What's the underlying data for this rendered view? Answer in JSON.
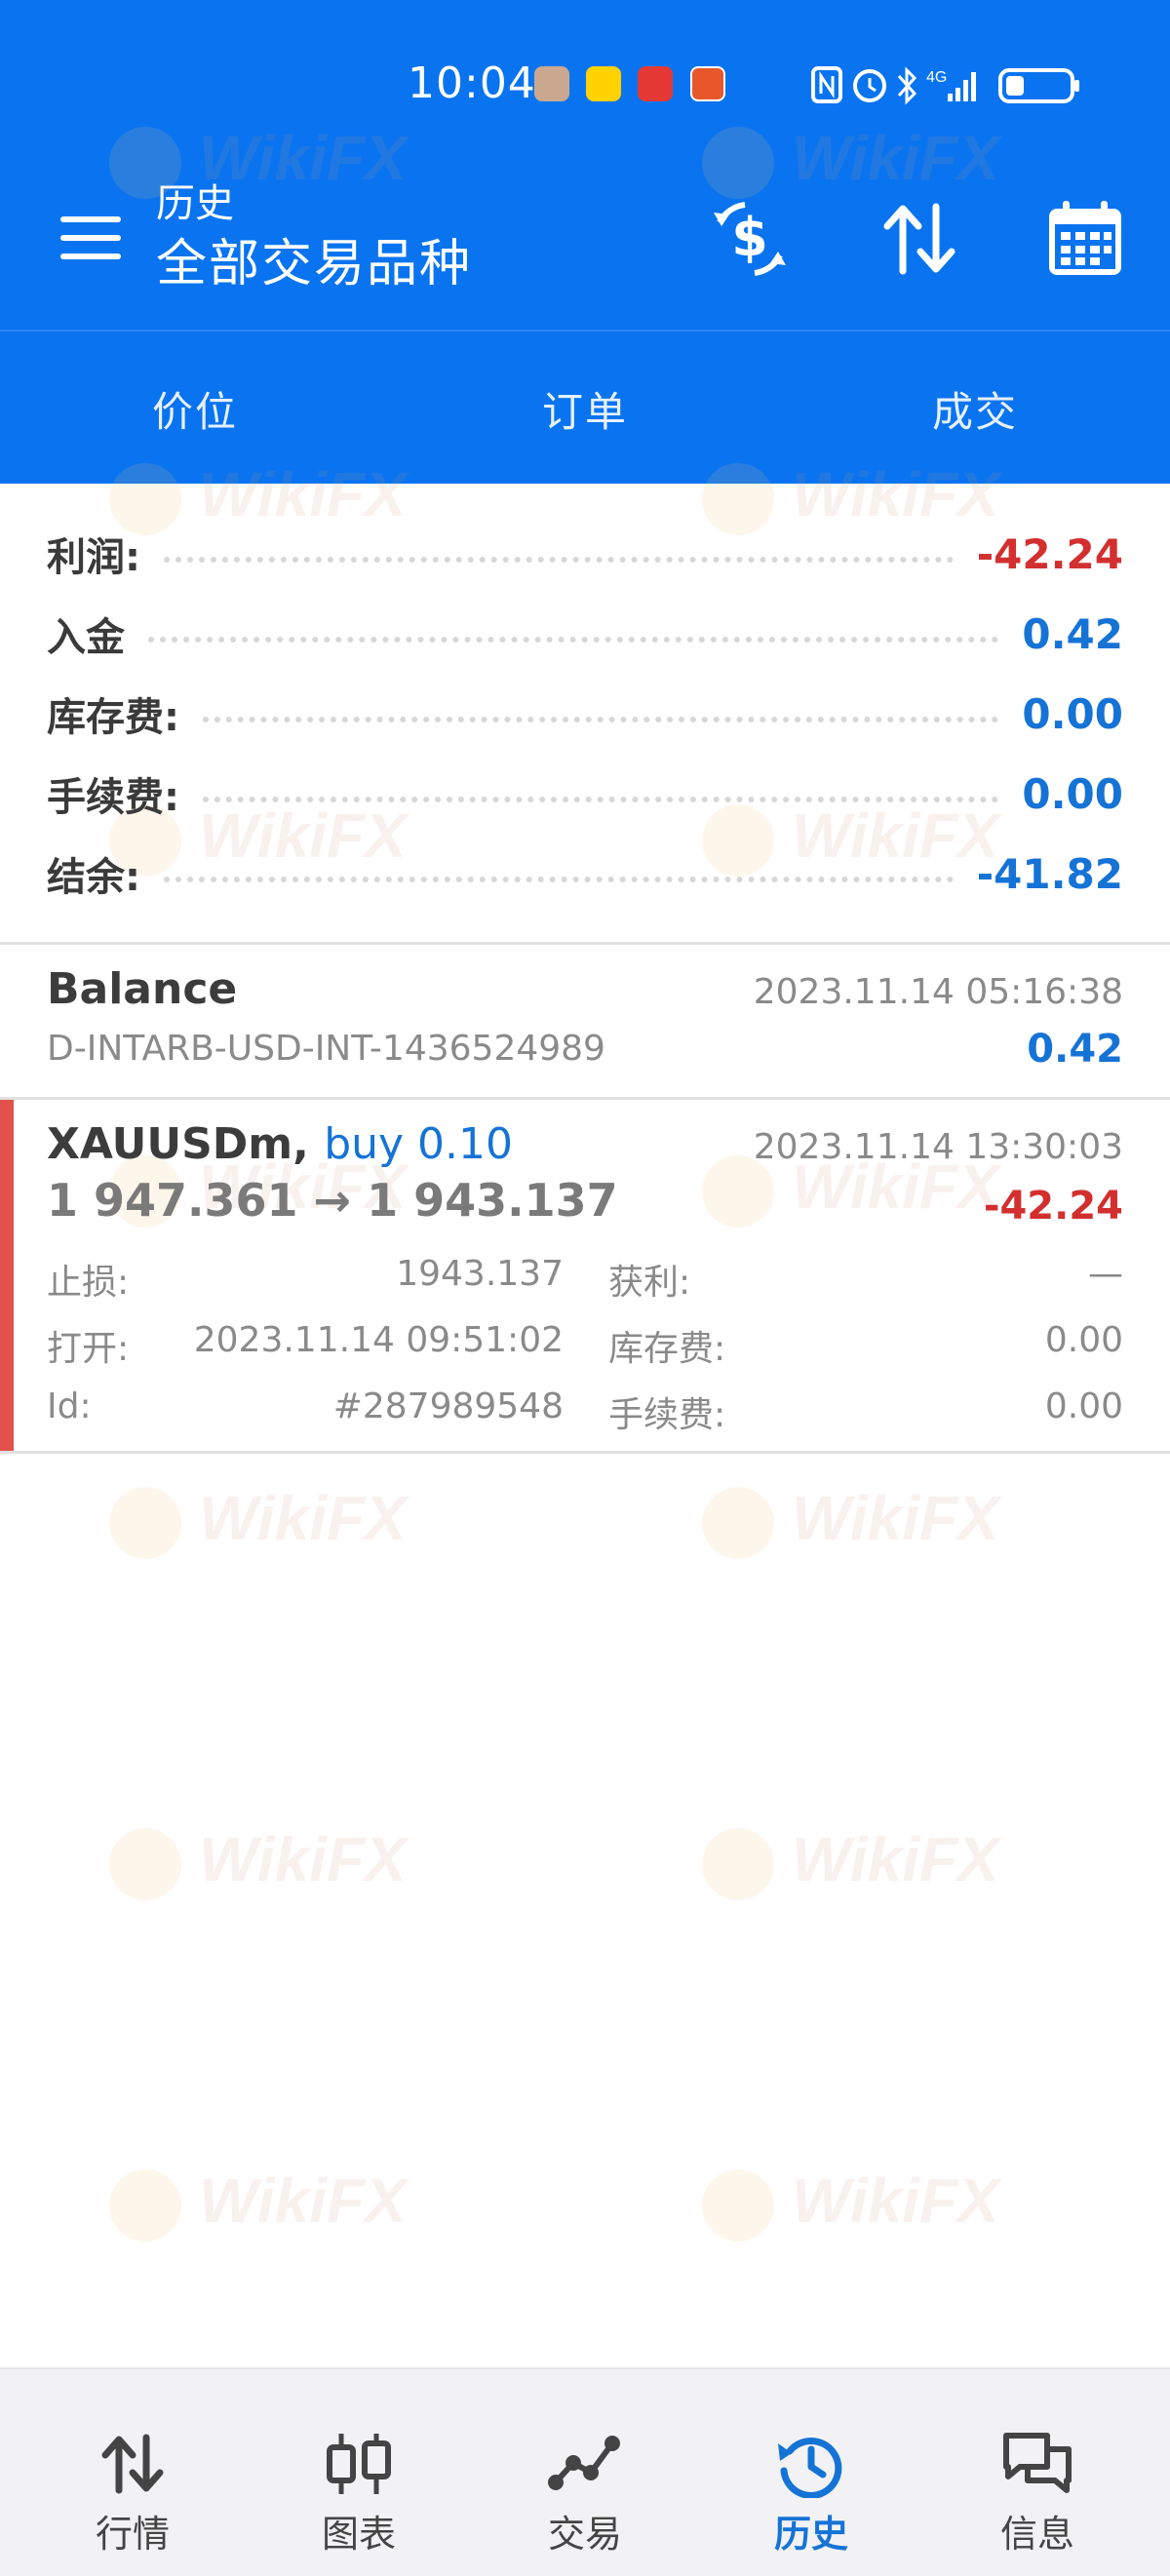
{
  "status_bar": {
    "time": "10:04"
  },
  "app_bar": {
    "subtitle": "历史",
    "title": "全部交易品种"
  },
  "tabs": [
    {
      "label": "价位"
    },
    {
      "label": "订单"
    },
    {
      "label": "成交"
    }
  ],
  "summary": {
    "profit": {
      "label": "利润:",
      "value": "-42.24"
    },
    "deposit": {
      "label": "入金",
      "value": "0.42"
    },
    "swap": {
      "label": "库存费:",
      "value": "0.00"
    },
    "commission": {
      "label": "手续费:",
      "value": "0.00"
    },
    "balance": {
      "label": "结余:",
      "value": "-41.82"
    }
  },
  "history": [
    {
      "type": "balance",
      "title": "Balance",
      "datetime": "2023.11.14 05:16:38",
      "comment": "D-INTARB-USD-INT-1436524989",
      "amount": "0.42"
    },
    {
      "type": "deal",
      "symbol": "XAUUSDm,",
      "side": "buy 0.10",
      "datetime": "2023.11.14 13:30:03",
      "prices": "1 947.361 → 1 943.137",
      "profit": "-42.24",
      "sl_label": "止损:",
      "sl_value": "1943.137",
      "tp_label": "获利:",
      "tp_value": "—",
      "open_label": "打开:",
      "open_value": "2023.11.14 09:51:02",
      "swap_label": "库存费:",
      "swap_value": "0.00",
      "id_label": "Id:",
      "id_value": "#287989548",
      "commission_label": "手续费:",
      "commission_value": "0.00"
    }
  ],
  "watermark": "WikiFX",
  "bottom_nav": [
    {
      "label": "行情",
      "icon": "quotes-icon"
    },
    {
      "label": "图表",
      "icon": "chart-icon"
    },
    {
      "label": "交易",
      "icon": "trade-icon"
    },
    {
      "label": "历史",
      "icon": "history-icon",
      "active": true
    },
    {
      "label": "信息",
      "icon": "messages-icon"
    }
  ],
  "colors": {
    "primary": "#0a74f0",
    "negative": "#d32f2f",
    "positive": "#1673d6",
    "accent_bar": "#e2524a"
  }
}
